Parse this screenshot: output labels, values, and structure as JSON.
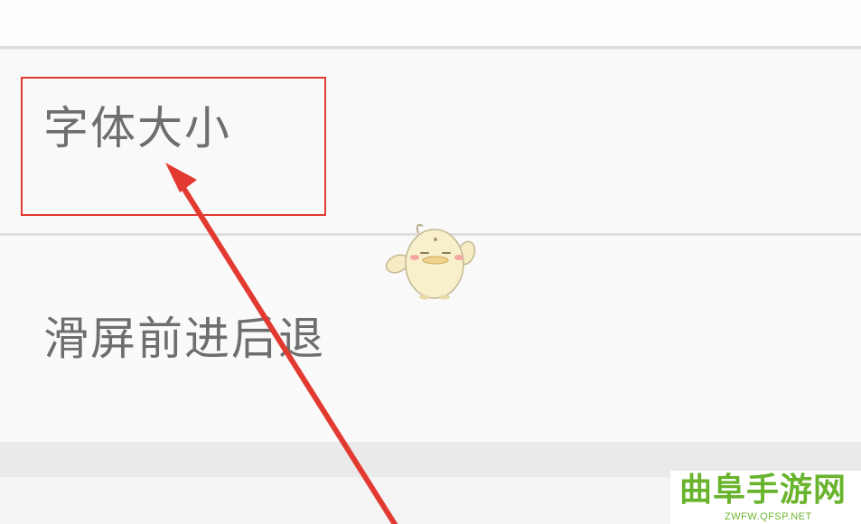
{
  "settings": {
    "items": [
      {
        "label": "字体大小",
        "highlighted": true
      },
      {
        "label": "滑屏前进后退",
        "highlighted": false
      }
    ]
  },
  "annotation": {
    "box_color": "#e23a31",
    "arrow_color": "#e23a31"
  },
  "mascot": {
    "icon": "chick-mascot-icon"
  },
  "watermark": {
    "title": "曲阜手游网",
    "url": "ZWFW.QFSP.NET",
    "color": "#6ab42d"
  }
}
